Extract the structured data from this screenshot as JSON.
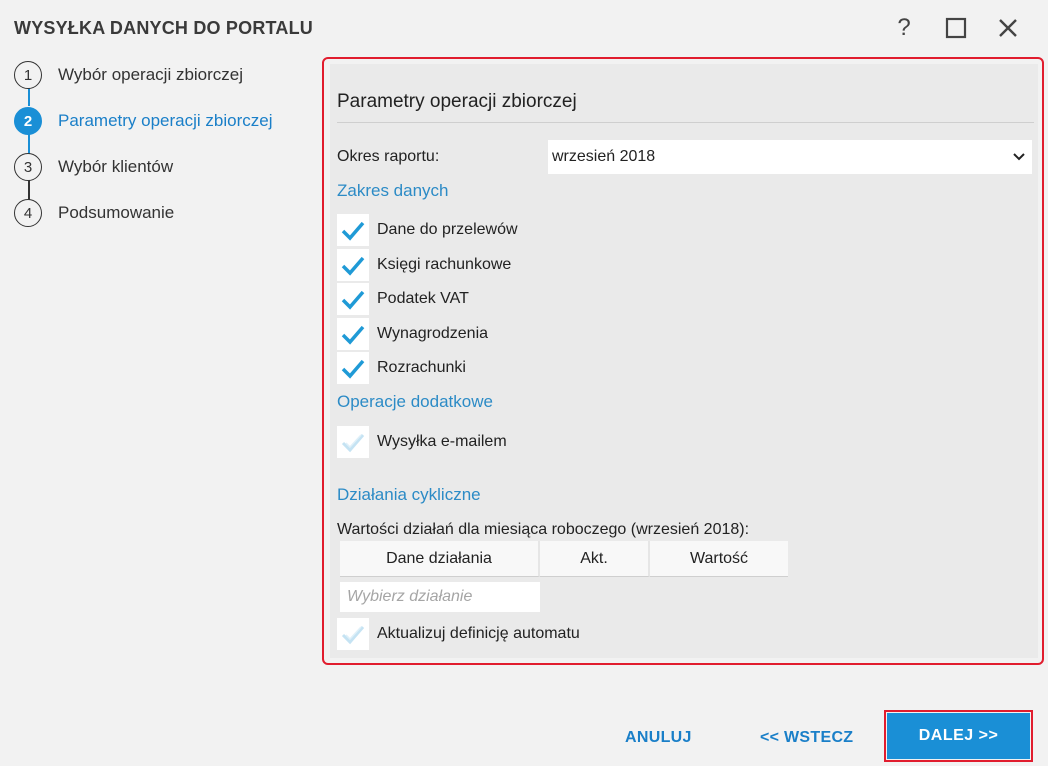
{
  "window": {
    "title": "WYSYŁKA DANYCH DO PORTALU"
  },
  "steps": [
    {
      "number": "1",
      "label": "Wybór operacji zbiorczej",
      "active": false
    },
    {
      "number": "2",
      "label": "Parametry operacji zbiorczej",
      "active": true
    },
    {
      "number": "3",
      "label": "Wybór klientów",
      "active": false
    },
    {
      "number": "4",
      "label": "Podsumowanie",
      "active": false
    }
  ],
  "panel": {
    "title": "Parametry operacji zbiorczej",
    "period_label": "Okres raportu:",
    "period_value": "wrzesień 2018",
    "data_scope": {
      "title": "Zakres danych",
      "items": [
        {
          "label": "Dane do przelewów",
          "checked": true
        },
        {
          "label": "Księgi rachunkowe",
          "checked": true
        },
        {
          "label": "Podatek VAT",
          "checked": true
        },
        {
          "label": "Wynagrodzenia",
          "checked": true
        },
        {
          "label": "Rozrachunki",
          "checked": true
        }
      ]
    },
    "extra_ops": {
      "title": "Operacje dodatkowe",
      "items": [
        {
          "label": "Wysyłka e-mailem",
          "checked": false
        }
      ]
    },
    "cyclic": {
      "title": "Działania cykliczne",
      "subtitle": "Wartości działań dla miesiąca roboczego (wrzesień 2018):",
      "columns": [
        "Dane działania",
        "Akt.",
        "Wartość"
      ],
      "select_placeholder": "Wybierz działanie",
      "auto_update_label": "Aktualizuj definicję automatu",
      "auto_update_checked": false
    }
  },
  "footer": {
    "cancel": "ANULUJ",
    "back": "<< WSTECZ",
    "next": "DALEJ >>"
  },
  "colors": {
    "accent": "#1a8fd6",
    "highlight": "#e11d2e"
  }
}
